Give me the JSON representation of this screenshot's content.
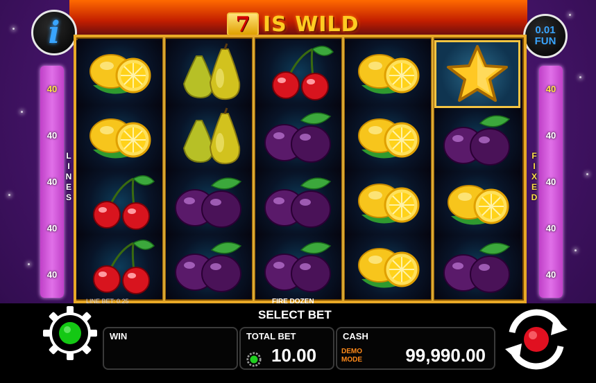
{
  "title": {
    "seven": "7",
    "text": "IS WILD"
  },
  "info_button": {
    "label": "i"
  },
  "coin": {
    "value": "0.01",
    "currency": "FUN"
  },
  "lines_left": [
    "40",
    "40",
    "40",
    "40",
    "40"
  ],
  "lines_right": [
    "40",
    "40",
    "40",
    "40",
    "40"
  ],
  "lines_label": "LINES",
  "fixed_label": "FIXED",
  "reels": [
    [
      "lemon",
      "lemon",
      "cherry",
      "cherry"
    ],
    [
      "pear",
      "pear",
      "plum",
      "plum"
    ],
    [
      "cherry",
      "plum",
      "plum",
      "plum"
    ],
    [
      "lemon",
      "lemon",
      "lemon",
      "lemon"
    ],
    [
      "star",
      "plum",
      "lemon",
      "plum"
    ]
  ],
  "line_bet": "LINE BET: 0.25",
  "game_name": "FIRE DOZEN",
  "select_bet": "SELECT BET",
  "win": {
    "label": "WIN",
    "value": ""
  },
  "total_bet": {
    "label": "TOTAL BET",
    "value": "10.00"
  },
  "cash": {
    "label": "CASH",
    "mode_line1": "DEMO",
    "mode_line2": "MODE",
    "value": "99,990.00"
  },
  "colors": {
    "accent_gold": "#f4c542",
    "info_blue": "#39a5ff",
    "spin_red": "#e01020",
    "go_green": "#20d020",
    "demo_orange": "#ff8a1a"
  }
}
